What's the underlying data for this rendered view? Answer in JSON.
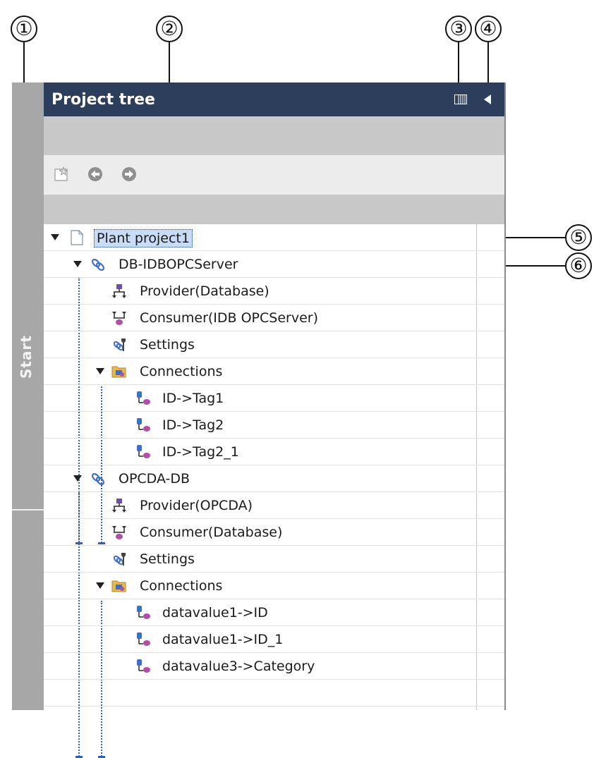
{
  "callouts": [
    "①",
    "②",
    "③",
    "④",
    "⑤",
    "⑥"
  ],
  "sidebar": {
    "start_label": "Start"
  },
  "panel": {
    "title": "Project tree"
  },
  "toolbar": {
    "buttons": [
      {
        "name": "new-item-icon"
      },
      {
        "name": "back-arrow-icon"
      },
      {
        "name": "forward-arrow-icon"
      }
    ]
  },
  "tree": {
    "root": {
      "label": "Plant project1",
      "icon": "project-icon",
      "expanded": true,
      "selected": true
    },
    "items": [
      {
        "label": "DB-IDBOPCServer",
        "icon": "link-icon",
        "level": 1,
        "expanded": true
      },
      {
        "label": "Provider(Database)",
        "icon": "provider-icon",
        "level": 2
      },
      {
        "label": "Consumer(IDB OPCServer)",
        "icon": "consumer-icon",
        "level": 2
      },
      {
        "label": "Settings",
        "icon": "settings-icon",
        "level": 2
      },
      {
        "label": "Connections",
        "icon": "folder-icon",
        "level": 2,
        "expanded": true
      },
      {
        "label": "ID->Tag1",
        "icon": "connection-icon",
        "level": 3
      },
      {
        "label": "ID->Tag2",
        "icon": "connection-icon",
        "level": 3
      },
      {
        "label": "ID->Tag2_1",
        "icon": "connection-icon",
        "level": 3
      },
      {
        "label": "OPCDA-DB",
        "icon": "link-icon",
        "level": 1,
        "expanded": true
      },
      {
        "label": "Provider(OPCDA)",
        "icon": "provider-icon",
        "level": 2
      },
      {
        "label": "Consumer(Database)",
        "icon": "consumer-icon",
        "level": 2
      },
      {
        "label": "Settings",
        "icon": "settings-icon",
        "level": 2
      },
      {
        "label": "Connections",
        "icon": "folder-icon",
        "level": 2,
        "expanded": true
      },
      {
        "label": "datavalue1->ID",
        "icon": "connection-icon",
        "level": 3
      },
      {
        "label": "datavalue1->ID_1",
        "icon": "connection-icon",
        "level": 3
      },
      {
        "label": "datavalue3->Category",
        "icon": "connection-icon",
        "level": 3
      }
    ]
  },
  "colors": {
    "titlebar": "#2c3e5b",
    "sidebar": "#a7a7a7",
    "selection": "#c9dcf5",
    "tree_lines": "#2f5fb8"
  }
}
